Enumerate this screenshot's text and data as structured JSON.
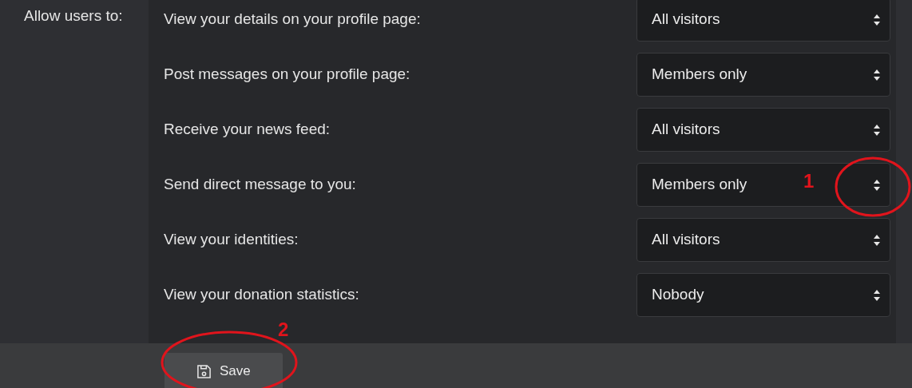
{
  "section_label": "Allow users to:",
  "settings": [
    {
      "label": "View your details on your profile page:",
      "value": "All visitors"
    },
    {
      "label": "Post messages on your profile page:",
      "value": "Members only"
    },
    {
      "label": "Receive your news feed:",
      "value": "All visitors"
    },
    {
      "label": "Send direct message to you:",
      "value": "Members only"
    },
    {
      "label": "View your identities:",
      "value": "All visitors"
    },
    {
      "label": "View your donation statistics:",
      "value": "Nobody"
    }
  ],
  "save_button": {
    "label": "Save"
  },
  "annotations": [
    {
      "number": "1"
    },
    {
      "number": "2"
    }
  ]
}
